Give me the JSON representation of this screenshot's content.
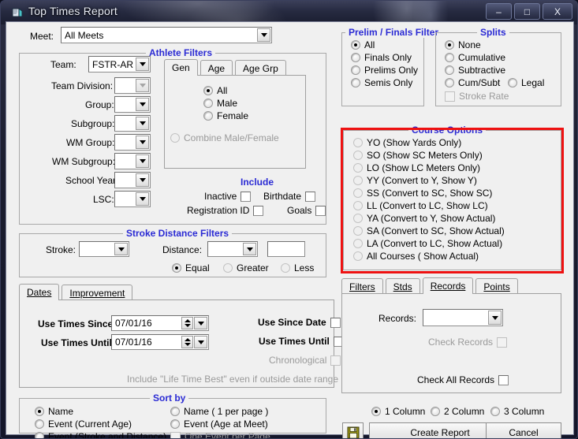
{
  "window": {
    "title": "Top Times Report",
    "icon": "report-window-icon",
    "minimize": "–",
    "maximize": "□",
    "close": "X"
  },
  "meet": {
    "label": "Meet:",
    "value": "All Meets"
  },
  "athlete_filters": {
    "caption": "Athlete Filters",
    "fields": [
      {
        "label": "Team:",
        "value": "FSTR-AR",
        "enabled": true
      },
      {
        "label": "Team Division:",
        "value": "",
        "enabled": false
      },
      {
        "label": "Group:",
        "value": "",
        "enabled": true
      },
      {
        "label": "Subgroup:",
        "value": "",
        "enabled": true
      },
      {
        "label": "WM Group:",
        "value": "",
        "enabled": true
      },
      {
        "label": "WM Subgroup:",
        "value": "",
        "enabled": true
      },
      {
        "label": "School Year:",
        "value": "",
        "enabled": true
      },
      {
        "label": "LSC:",
        "value": "",
        "enabled": true
      }
    ],
    "gender_tabs": [
      {
        "label": "Gen",
        "active": true
      },
      {
        "label": "Age",
        "active": false
      },
      {
        "label": "Age Grp",
        "active": false
      }
    ],
    "gender_options": [
      {
        "label": "All",
        "selected": true,
        "enabled": true
      },
      {
        "label": "Male",
        "selected": false,
        "enabled": true
      },
      {
        "label": "Female",
        "selected": false,
        "enabled": true
      },
      {
        "label": "Combine Male/Female",
        "selected": false,
        "enabled": false
      }
    ],
    "include": {
      "caption": "Include",
      "items": [
        {
          "label": "Inactive",
          "checked": false
        },
        {
          "label": "Birthdate",
          "checked": false
        },
        {
          "label": "Registration ID",
          "checked": false
        },
        {
          "label": "Goals",
          "checked": false
        }
      ]
    }
  },
  "stroke_distance_filters": {
    "caption": "Stroke Distance Filters",
    "stroke_label": "Stroke:",
    "stroke_value": "",
    "distance_label": "Distance:",
    "distance_value": "",
    "distance_text": "",
    "comparison": [
      {
        "label": "Equal",
        "selected": true,
        "enabled": true
      },
      {
        "label": "Greater",
        "selected": false,
        "enabled": false
      },
      {
        "label": "Less",
        "selected": false,
        "enabled": false
      }
    ]
  },
  "dates_tabs": [
    {
      "label": "Dates",
      "accel": "D",
      "active": true
    },
    {
      "label": "Improvement",
      "accel": "I",
      "active": false
    }
  ],
  "dates": {
    "since_label": "Use Times Since:",
    "since_value": "07/01/16",
    "until_label": "Use Times Until:",
    "until_value": "07/01/16",
    "checks": [
      {
        "label": "Use Since Date",
        "checked": false,
        "enabled": true
      },
      {
        "label": "Use Times Until",
        "checked": false,
        "enabled": true
      },
      {
        "label": "Chronological",
        "checked": false,
        "enabled": false
      },
      {
        "label": "Include \"Life Time Best\" even if outside date range",
        "checked": false,
        "enabled": false
      }
    ]
  },
  "sort_by": {
    "caption": "Sort by",
    "left": [
      {
        "label": "Name",
        "selected": true,
        "enabled": true
      },
      {
        "label": "Event (Current Age)",
        "selected": false,
        "enabled": true
      },
      {
        "label": "Event (Stroke and Distance)",
        "selected": false,
        "enabled": true
      }
    ],
    "right": [
      {
        "label": "Name ( 1 per page )",
        "selected": false,
        "enabled": true
      },
      {
        "label": "Event  (Age at Meet)",
        "selected": false,
        "enabled": true
      }
    ],
    "one_event_per_page": {
      "label": "One Event per Page",
      "checked": false,
      "enabled": false
    }
  },
  "prelim_finals_filter": {
    "caption": "Prelim / Finals Filter",
    "options": [
      {
        "label": "All",
        "selected": true
      },
      {
        "label": "Finals Only",
        "selected": false
      },
      {
        "label": "Prelims Only",
        "selected": false
      },
      {
        "label": "Semis Only",
        "selected": false
      }
    ]
  },
  "splits": {
    "caption": "Splits",
    "options": [
      {
        "label": "None",
        "selected": true
      },
      {
        "label": "Cumulative",
        "selected": false
      },
      {
        "label": "Subtractive",
        "selected": false
      },
      {
        "label": "Cum/Subt",
        "selected": false
      }
    ],
    "legal": {
      "label": "Legal",
      "selected": false
    },
    "stroke_rate": {
      "label": "Stroke Rate",
      "checked": false,
      "enabled": false
    }
  },
  "course_options": {
    "caption": "Course Options",
    "highlighted": true,
    "highlight_color": "#ee1111",
    "options": [
      {
        "label": "YO (Show Yards Only)",
        "selected": false
      },
      {
        "label": "SO (Show SC Meters Only)",
        "selected": false
      },
      {
        "label": "LO (Show LC Meters Only)",
        "selected": false
      },
      {
        "label": "YY (Convert to Y, Show Y)",
        "selected": false
      },
      {
        "label": "SS (Convert to SC, Show SC)",
        "selected": false
      },
      {
        "label": "LL (Convert to LC, Show LC)",
        "selected": false
      },
      {
        "label": "YA (Convert to Y, Show Actual)",
        "selected": false
      },
      {
        "label": "SA (Convert to SC, Show Actual)",
        "selected": false
      },
      {
        "label": "LA (Convert to LC, Show Actual)",
        "selected": false
      },
      {
        "label": "All Courses ( Show Actual)",
        "selected": false
      }
    ]
  },
  "right_tabs": [
    {
      "label": "Filters",
      "accel": "F",
      "active": false
    },
    {
      "label": "Stds",
      "accel": "S",
      "active": false
    },
    {
      "label": "Records",
      "accel": "R",
      "active": true
    },
    {
      "label": "Points",
      "accel": "P",
      "active": false
    }
  ],
  "records_pane": {
    "label": "Records:",
    "value": "",
    "check_records": {
      "label": "Check Records",
      "checked": false,
      "enabled": false
    },
    "check_all_records": {
      "label": "Check All Records",
      "checked": false,
      "enabled": true
    }
  },
  "columns": [
    {
      "label": "1 Column",
      "selected": true
    },
    {
      "label": "2 Column",
      "selected": false
    },
    {
      "label": "3 Column",
      "selected": false
    }
  ],
  "actions": {
    "save_icon": "floppy-disk-save-icon",
    "create_report": "Create Report",
    "cancel": "Cancel"
  }
}
